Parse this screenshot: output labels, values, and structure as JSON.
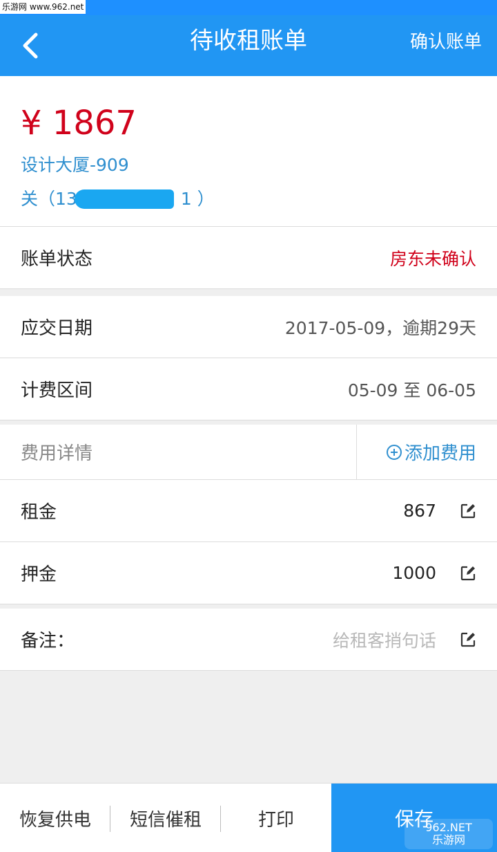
{
  "watermark": {
    "top": "乐游网 www.962.net",
    "logo_line1": "962.NET",
    "logo_line2": "乐游网"
  },
  "header": {
    "title": "待收租账单",
    "confirm_label": "确认账单"
  },
  "summary": {
    "amount": "¥ 1867",
    "building": "设计大厦-909",
    "tenant_prefix": "关（13",
    "tenant_suffix": "1 ）"
  },
  "status": {
    "label": "账单状态",
    "value": "房东未确认"
  },
  "due": {
    "label": "应交日期",
    "value": "2017-05-09，逾期29天"
  },
  "period": {
    "label": "计费区间",
    "value": "05-09 至 06-05"
  },
  "fees": {
    "header_label": "费用详情",
    "add_label": "添加费用",
    "items": [
      {
        "name": "租金",
        "amount": "867"
      },
      {
        "name": "押金",
        "amount": "1000"
      }
    ]
  },
  "note": {
    "label": "备注：",
    "placeholder": "给租客捎句话"
  },
  "bottom": {
    "power": "恢复供电",
    "sms": "短信催租",
    "print": "打印",
    "save": "保存"
  },
  "colors": {
    "primary": "#2196f3",
    "accent_red": "#d0021b",
    "link_blue": "#2f8fcf"
  }
}
